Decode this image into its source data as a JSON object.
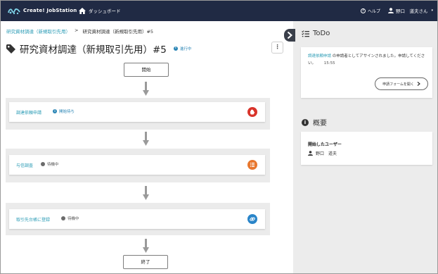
{
  "header": {
    "brand": "Create! JobStation",
    "dashboard_label": "ダッシュボード",
    "help_label": "ヘルプ",
    "user_label": "野口　道夫さん"
  },
  "breadcrumb": {
    "parent": "研究資材調達（新規取引先用）",
    "separator": ">",
    "current": "研究資材調達（新規取引先用）#5"
  },
  "page": {
    "title": "研究資材調達（新規取引先用）#5",
    "status": "進行中",
    "more_label": "⋮"
  },
  "flow": {
    "start_label": "開始",
    "end_label": "終了",
    "steps": [
      {
        "name": "調達依頼申請",
        "status": "開始待ち",
        "icon": "hand-stop-icon",
        "color": "#d9342b"
      },
      {
        "name": "与信調査",
        "status": "待機中",
        "icon": "list-icon",
        "color": "#e8772e"
      },
      {
        "name": "取引先台帳に登録",
        "status": "待機中",
        "icon": "link-icon",
        "color": "#2a85c9"
      }
    ]
  },
  "todo": {
    "heading": "ToDo",
    "link_text": "調達依頼申請",
    "message": "の申請者としてアサインされました。申請してください。",
    "time": "15:55",
    "button_label": "申請フォームを開く"
  },
  "overview": {
    "heading": "概要",
    "starter_label": "開始したユーザー",
    "starter_name": "野口　道夫"
  },
  "colors": {
    "header_bg": "#202a44",
    "link": "#2a9bb5",
    "panel_bg": "#ececec"
  }
}
